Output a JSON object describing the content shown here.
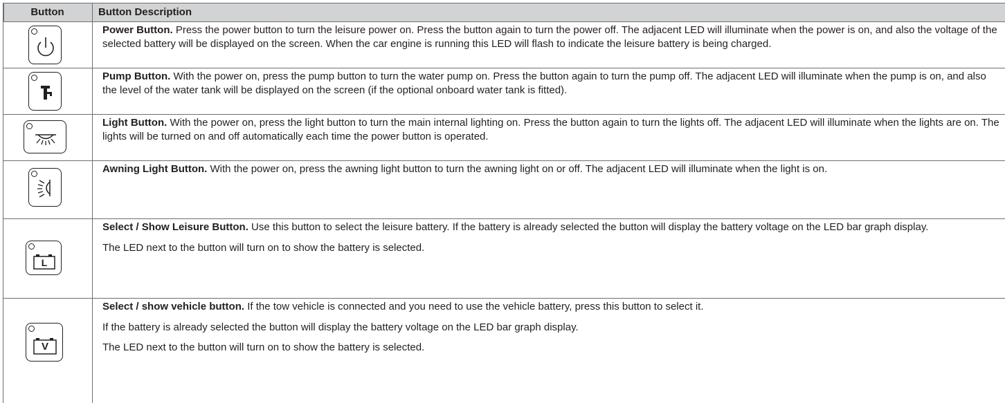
{
  "header": {
    "col_button": "Button",
    "col_description": "Button Description"
  },
  "rows": [
    {
      "icon": "power-icon",
      "title": "Power Button.",
      "text": " Press the power button to turn the leisure power on. Press the button again to turn the power off. The adjacent LED will illuminate when the power is on, and also the voltage of the selected battery will be displayed on the screen. When the car engine is running this LED will flash to indicate the leisure battery is being charged."
    },
    {
      "icon": "water-tap-icon",
      "title": "Pump Button.",
      "text": " With the power on, press the pump button to turn the water pump on. Press the button again to turn the pump off. The adjacent LED will illuminate when the pump is on, and also the level of the water tank will be displayed on the screen (if the optional onboard water tank is fitted)."
    },
    {
      "icon": "ceiling-light-icon",
      "title": "Light Button.",
      "text": " With the power on, press the light button to turn the main internal lighting on. Press the button again to turn the lights off. The adjacent LED will illuminate when the lights are on. The lights will be turned on and off automatically each time the power button is operated."
    },
    {
      "icon": "awning-light-icon",
      "title": "Awning Light Button.",
      "text": " With the power on, press the awning light button to turn the awning light on or off. The adjacent LED will illuminate when the light is on."
    },
    {
      "icon": "leisure-battery-icon",
      "icon_letter": "L",
      "title": "Select / Show Leisure Button.",
      "text": " Use this button to select the leisure battery. If the battery is already selected the button will display the battery voltage on the LED bar graph display.",
      "extra": [
        "The LED next to the button will turn on to show the battery is selected."
      ]
    },
    {
      "icon": "vehicle-battery-icon",
      "icon_letter": "V",
      "title": "Select / show vehicle button.",
      "text": " If the tow vehicle is connected and you need to use the vehicle battery, press this button to select it.",
      "extra": [
        "If the battery is already selected the button will display the battery voltage on the LED bar graph display.",
        "The LED next to the button will turn on to show the battery is selected."
      ]
    }
  ]
}
